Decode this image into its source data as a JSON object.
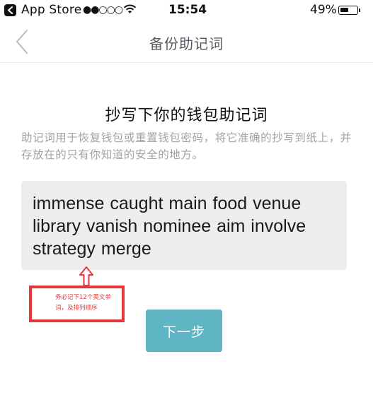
{
  "status_bar": {
    "back_app": "App Store",
    "signal": "●●○○○",
    "time": "15:54",
    "battery": "49%"
  },
  "nav": {
    "title": "备份助记词"
  },
  "content": {
    "heading": "抄写下你的钱包助记词",
    "description": "助记词用于恢复钱包或重置钱包密码，将它准确的抄写到纸上，并存放在的只有你知道的安全的地方。",
    "mnemonic": "immense caught main food venue library vanish nominee aim involve strategy merge"
  },
  "annotation": {
    "note": "务必记下12个英文单词，及排列顺序",
    "color": "#e8373a"
  },
  "actions": {
    "next_label": "下一步"
  },
  "colors": {
    "accent": "#5fb5c4",
    "phrase_bg": "#ededed",
    "description_text": "#a3a3a3"
  }
}
